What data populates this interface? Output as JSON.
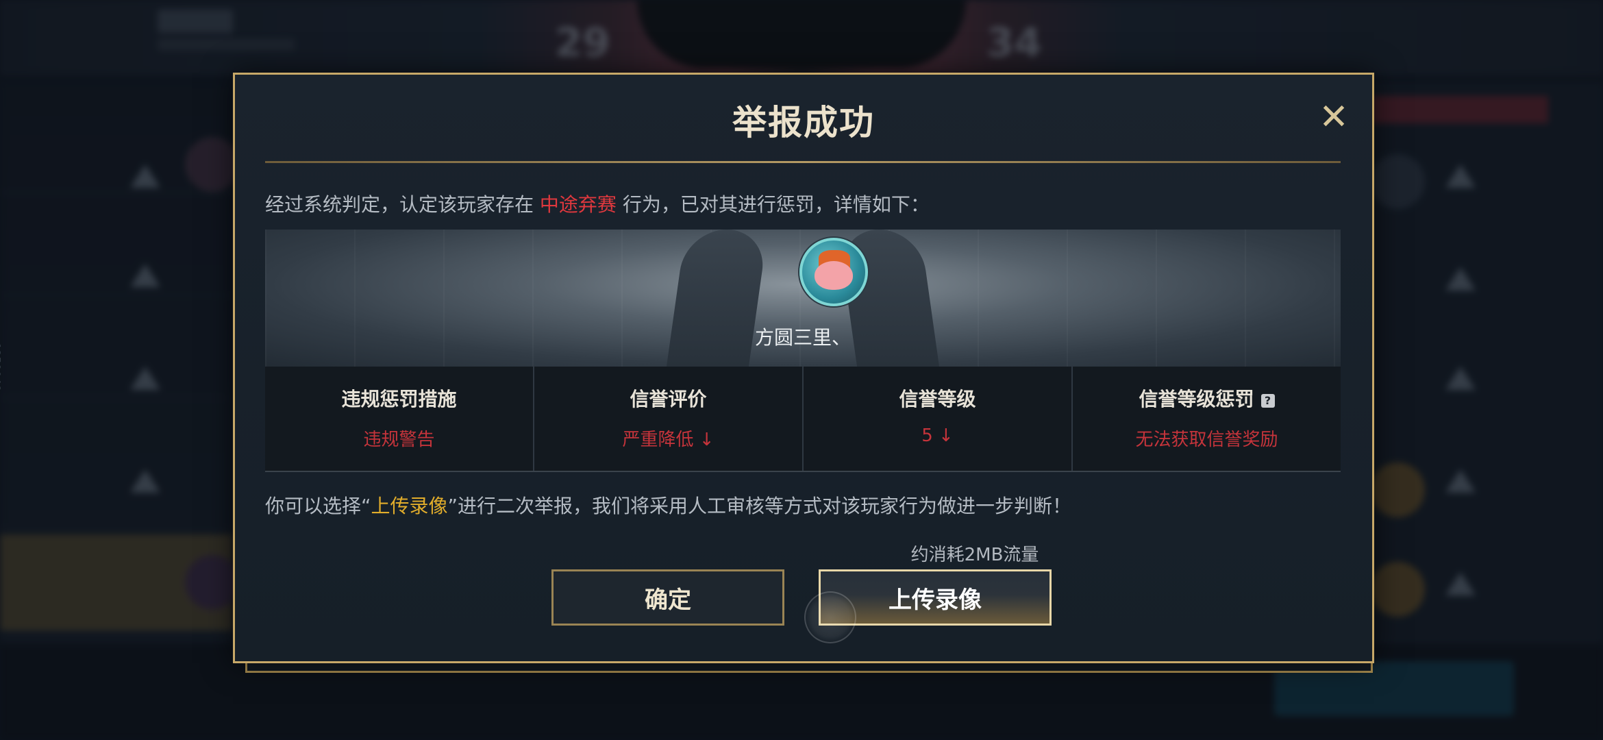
{
  "background": {
    "score_left": "29",
    "score_right": "34",
    "side_id": "1358048"
  },
  "dialog": {
    "title": "举报成功",
    "close_icon": "close-icon",
    "verdict": {
      "prefix": "经过系统判定，认定该玩家存在",
      "behavior": "中途弃赛",
      "suffix": "行为，已对其进行惩罚，详情如下："
    },
    "player": {
      "name": "方圆三里、"
    },
    "stats": [
      {
        "title": "违规惩罚措施",
        "value": "违规警告"
      },
      {
        "title": "信誉评价",
        "value": "严重降低 ↓"
      },
      {
        "title": "信誉等级",
        "value": "5 ↓"
      },
      {
        "title": "信誉等级惩罚",
        "value": "无法获取信誉奖励",
        "help": "?"
      }
    ],
    "second_report": {
      "prefix": "你可以选择“",
      "highlight": "上传录像",
      "suffix": "”进行二次举报，我们将采用人工审核等方式对该玩家行为做进一步判断！"
    },
    "traffic_note": "约消耗2MB流量",
    "buttons": {
      "confirm": "确定",
      "upload": "上传录像"
    },
    "colors": {
      "border_gold": "#c7a868",
      "highlight_red": "#e0383e",
      "highlight_gold": "#e2ad2b",
      "stat_value_red": "#c6343b"
    }
  }
}
